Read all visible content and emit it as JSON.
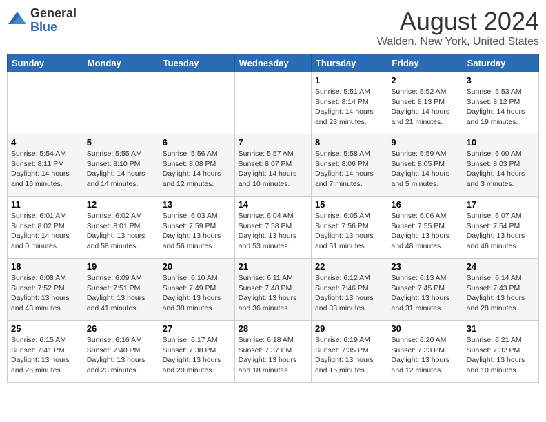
{
  "logo": {
    "general": "General",
    "blue": "Blue"
  },
  "header": {
    "month": "August 2024",
    "location": "Walden, New York, United States"
  },
  "weekdays": [
    "Sunday",
    "Monday",
    "Tuesday",
    "Wednesday",
    "Thursday",
    "Friday",
    "Saturday"
  ],
  "weeks": [
    [
      {
        "day": "",
        "info": ""
      },
      {
        "day": "",
        "info": ""
      },
      {
        "day": "",
        "info": ""
      },
      {
        "day": "",
        "info": ""
      },
      {
        "day": "1",
        "info": "Sunrise: 5:51 AM\nSunset: 8:14 PM\nDaylight: 14 hours\nand 23 minutes."
      },
      {
        "day": "2",
        "info": "Sunrise: 5:52 AM\nSunset: 8:13 PM\nDaylight: 14 hours\nand 21 minutes."
      },
      {
        "day": "3",
        "info": "Sunrise: 5:53 AM\nSunset: 8:12 PM\nDaylight: 14 hours\nand 19 minutes."
      }
    ],
    [
      {
        "day": "4",
        "info": "Sunrise: 5:54 AM\nSunset: 8:11 PM\nDaylight: 14 hours\nand 16 minutes."
      },
      {
        "day": "5",
        "info": "Sunrise: 5:55 AM\nSunset: 8:10 PM\nDaylight: 14 hours\nand 14 minutes."
      },
      {
        "day": "6",
        "info": "Sunrise: 5:56 AM\nSunset: 8:08 PM\nDaylight: 14 hours\nand 12 minutes."
      },
      {
        "day": "7",
        "info": "Sunrise: 5:57 AM\nSunset: 8:07 PM\nDaylight: 14 hours\nand 10 minutes."
      },
      {
        "day": "8",
        "info": "Sunrise: 5:58 AM\nSunset: 8:06 PM\nDaylight: 14 hours\nand 7 minutes."
      },
      {
        "day": "9",
        "info": "Sunrise: 5:59 AM\nSunset: 8:05 PM\nDaylight: 14 hours\nand 5 minutes."
      },
      {
        "day": "10",
        "info": "Sunrise: 6:00 AM\nSunset: 8:03 PM\nDaylight: 14 hours\nand 3 minutes."
      }
    ],
    [
      {
        "day": "11",
        "info": "Sunrise: 6:01 AM\nSunset: 8:02 PM\nDaylight: 14 hours\nand 0 minutes."
      },
      {
        "day": "12",
        "info": "Sunrise: 6:02 AM\nSunset: 8:01 PM\nDaylight: 13 hours\nand 58 minutes."
      },
      {
        "day": "13",
        "info": "Sunrise: 6:03 AM\nSunset: 7:59 PM\nDaylight: 13 hours\nand 56 minutes."
      },
      {
        "day": "14",
        "info": "Sunrise: 6:04 AM\nSunset: 7:58 PM\nDaylight: 13 hours\nand 53 minutes."
      },
      {
        "day": "15",
        "info": "Sunrise: 6:05 AM\nSunset: 7:56 PM\nDaylight: 13 hours\nand 51 minutes."
      },
      {
        "day": "16",
        "info": "Sunrise: 6:06 AM\nSunset: 7:55 PM\nDaylight: 13 hours\nand 48 minutes."
      },
      {
        "day": "17",
        "info": "Sunrise: 6:07 AM\nSunset: 7:54 PM\nDaylight: 13 hours\nand 46 minutes."
      }
    ],
    [
      {
        "day": "18",
        "info": "Sunrise: 6:08 AM\nSunset: 7:52 PM\nDaylight: 13 hours\nand 43 minutes."
      },
      {
        "day": "19",
        "info": "Sunrise: 6:09 AM\nSunset: 7:51 PM\nDaylight: 13 hours\nand 41 minutes."
      },
      {
        "day": "20",
        "info": "Sunrise: 6:10 AM\nSunset: 7:49 PM\nDaylight: 13 hours\nand 38 minutes."
      },
      {
        "day": "21",
        "info": "Sunrise: 6:11 AM\nSunset: 7:48 PM\nDaylight: 13 hours\nand 36 minutes."
      },
      {
        "day": "22",
        "info": "Sunrise: 6:12 AM\nSunset: 7:46 PM\nDaylight: 13 hours\nand 33 minutes."
      },
      {
        "day": "23",
        "info": "Sunrise: 6:13 AM\nSunset: 7:45 PM\nDaylight: 13 hours\nand 31 minutes."
      },
      {
        "day": "24",
        "info": "Sunrise: 6:14 AM\nSunset: 7:43 PM\nDaylight: 13 hours\nand 28 minutes."
      }
    ],
    [
      {
        "day": "25",
        "info": "Sunrise: 6:15 AM\nSunset: 7:41 PM\nDaylight: 13 hours\nand 26 minutes."
      },
      {
        "day": "26",
        "info": "Sunrise: 6:16 AM\nSunset: 7:40 PM\nDaylight: 13 hours\nand 23 minutes."
      },
      {
        "day": "27",
        "info": "Sunrise: 6:17 AM\nSunset: 7:38 PM\nDaylight: 13 hours\nand 20 minutes."
      },
      {
        "day": "28",
        "info": "Sunrise: 6:18 AM\nSunset: 7:37 PM\nDaylight: 13 hours\nand 18 minutes."
      },
      {
        "day": "29",
        "info": "Sunrise: 6:19 AM\nSunset: 7:35 PM\nDaylight: 13 hours\nand 15 minutes."
      },
      {
        "day": "30",
        "info": "Sunrise: 6:20 AM\nSunset: 7:33 PM\nDaylight: 13 hours\nand 12 minutes."
      },
      {
        "day": "31",
        "info": "Sunrise: 6:21 AM\nSunset: 7:32 PM\nDaylight: 13 hours\nand 10 minutes."
      }
    ]
  ]
}
